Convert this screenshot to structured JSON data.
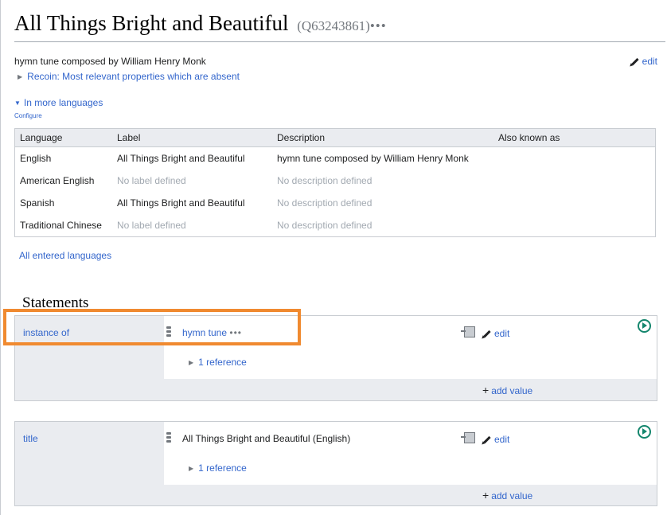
{
  "item": {
    "label": "All Things Bright and Beautiful",
    "qid": "(Q63243861)",
    "more_icon": "•••",
    "description": "hymn tune composed by William Henry Monk",
    "edit_label": "edit"
  },
  "recoin": {
    "label": "Recoin: Most relevant properties which are absent"
  },
  "languages": {
    "toggle_label": "In more languages",
    "configure_label": "Configure",
    "headers": [
      "Language",
      "Label",
      "Description",
      "Also known as"
    ],
    "rows": [
      [
        "English",
        "All Things Bright and Beautiful",
        "hymn tune composed by William Henry Monk",
        ""
      ],
      [
        "American English",
        "No label defined",
        "No description defined",
        ""
      ],
      [
        "Spanish",
        "All Things Bright and Beautiful",
        "No description defined",
        ""
      ],
      [
        "Traditional Chinese",
        "No label defined",
        "No description defined",
        ""
      ]
    ],
    "all_entered_label": "All entered languages"
  },
  "statements": {
    "heading": "Statements",
    "groups": [
      {
        "property": "instance of",
        "value": "hymn tune",
        "value_more": "•••",
        "reference": "1 reference",
        "edit_label": "edit",
        "add_value_label": "add value"
      },
      {
        "property": "title",
        "value": "All Things Bright and Beautiful (English)",
        "reference": "1 reference",
        "edit_label": "edit",
        "add_value_label": "add value"
      }
    ]
  },
  "colors": {
    "link": "#3366cc",
    "highlight": "#f08a30",
    "add_icon": "#14866d"
  },
  "icons": [
    "pencil-icon",
    "triangle-right-icon",
    "triangle-down-icon",
    "rank-icon",
    "import-icon",
    "add-statement-icon"
  ]
}
